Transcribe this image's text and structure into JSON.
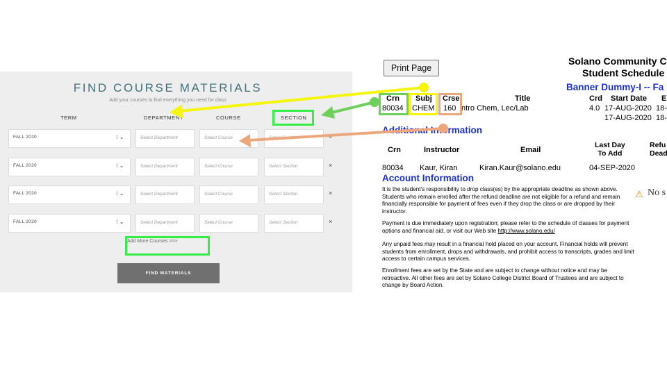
{
  "find_materials": {
    "title": "FIND COURSE MATERIALS",
    "subtitle": "Add your courses to find everything you need for class",
    "headers": {
      "term": "TERM",
      "department": "DEPARTMENT",
      "course": "COURSE",
      "section": "SECTION"
    },
    "rows": [
      {
        "term": "FALL 2020",
        "department": "Select Department",
        "course": "Select Course",
        "section": "Select Section"
      },
      {
        "term": "FALL 2020",
        "department": "Select Department",
        "course": "Select Course",
        "section": "Select Section"
      },
      {
        "term": "FALL 2020",
        "department": "Select Department",
        "course": "Select Course",
        "section": "Select Section"
      },
      {
        "term": "FALL 2020",
        "department": "Select Department",
        "course": "Select Course",
        "section": "Select Section"
      }
    ],
    "stepper_glyph": "⁝ ⌄",
    "remove_glyph": "×",
    "add_more": "Add More Courses >>>",
    "find_button": "FIND MATERIALS"
  },
  "schedule": {
    "print_button": "Print Page",
    "school": "Solano Community C",
    "schedule_title": "Student Schedule",
    "student": "Banner Dummy-I -- Fa",
    "course_headers": {
      "crn": "Crn",
      "subj": "Subj",
      "crse": "Crse",
      "title": "Title",
      "crd": "Crd",
      "start": "Start Date",
      "end": "E"
    },
    "course_row": {
      "crn": "80034",
      "subj": "CHEM",
      "crse": "160",
      "title": "Intro Chem, Lec/Lab",
      "crd": "4.0",
      "start1": "17-AUG-2020",
      "end1": "18-",
      "start2": "17-AUG-2020",
      "end2": "18-"
    },
    "additional_info": "Additional Information",
    "info_headers": {
      "crn": "Crn",
      "instructor": "Instructor",
      "email": "Email",
      "last_day_1": "Last Day",
      "last_day_2": "To Add",
      "refund_1": "Refu",
      "refund_2": "Dead"
    },
    "info_row": {
      "crn": "80034",
      "instructor": "Kaur, Kiran",
      "email": "Kiran.Kaur@solano.edu",
      "last_day": "04-SEP-2020"
    },
    "account_info": "Account Information",
    "paragraphs": {
      "p1": "It is the student's responsibility to drop class(es) by the appropriate deadline as shown above. Students who remain enrolled after the refund deadline are not eligible for a refund and remain financially responsible for payment of fees even if they drop the class or are dropped by their instructor.",
      "p2a": "Payment is due immediately upon registration; please refer to the schedule of classes for payment options and financial aid, or visit our Web site ",
      "p2_link": "http://www.solano.edu/",
      "p3": "Any unpaid fees may result in a financial hold placed on your account. Financial holds will prevent students from enrollment, drops and withdrawals, and prohibit access to transcripts, grades and limit access to certain campus services.",
      "p4": "Enrollment fees are set by the State and are subject to change without notice and may be retroactive. All other fees are set by Solano College District Board of Trustees and are subject to change by Board Action."
    },
    "warning_text": "No s"
  },
  "colors": {
    "yellow": "#f5f50f",
    "green": "#6ecf5a",
    "orange": "#eca77d",
    "highlight_green": "#33ee44",
    "link_blue": "#1a2fd6"
  }
}
